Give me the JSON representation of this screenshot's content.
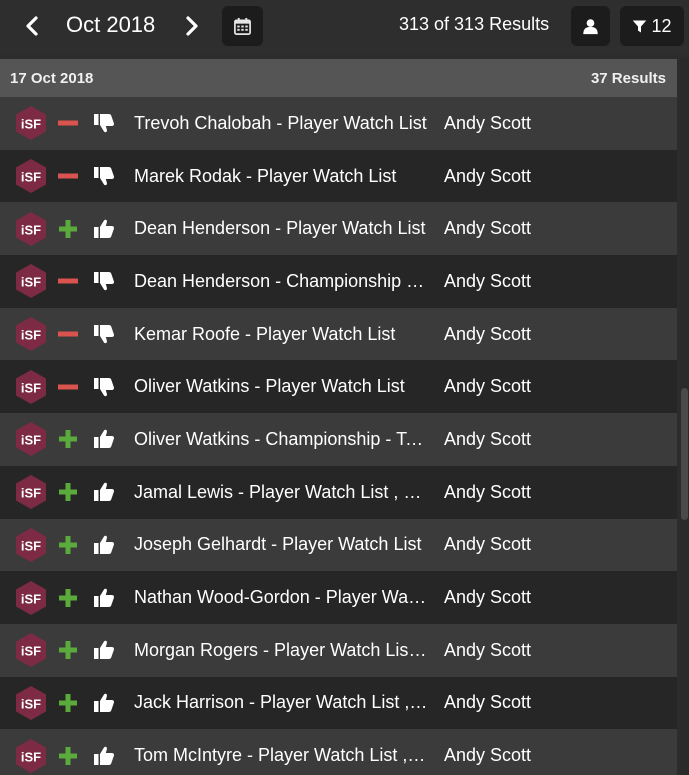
{
  "header": {
    "month": "Oct 2018",
    "results_summary": "313 of 313 Results",
    "filter_count": "12",
    "icons": {
      "prev": "chevron-left-icon",
      "next": "chevron-right-icon",
      "calendar": "calendar-icon",
      "user": "user-icon",
      "filter": "filter-icon"
    }
  },
  "section": {
    "date": "17 Oct 2018",
    "count": "37 Results"
  },
  "colors": {
    "logo_bg": "#7d2a45",
    "plus": "#5aaa3c",
    "minus": "#d9534f",
    "row_light": "#3b3b3b",
    "row_dark": "#262626",
    "header_bg": "#555555"
  },
  "logo_text": "iSF",
  "rows": [
    {
      "sentiment": "negative",
      "title": "Trevoh Chalobah - Player Watch List",
      "author": "Andy Scott"
    },
    {
      "sentiment": "negative",
      "title": "Marek Rodak - Player Watch List",
      "author": "Andy Scott"
    },
    {
      "sentiment": "positive",
      "title": "Dean Henderson - Player Watch List",
      "author": "Andy Scott"
    },
    {
      "sentiment": "negative",
      "title": "Dean Henderson - Championship - Team",
      "author": "Andy Scott"
    },
    {
      "sentiment": "negative",
      "title": "Kemar Roofe - Player Watch List",
      "author": "Andy Scott"
    },
    {
      "sentiment": "negative",
      "title": "Oliver Watkins - Player Watch List",
      "author": "Andy Scott"
    },
    {
      "sentiment": "positive",
      "title": "Oliver Watkins - Championship - Team",
      "author": "Andy Scott"
    },
    {
      "sentiment": "positive",
      "title": "Jamal Lewis - Player Watch List , Player",
      "author": "Andy Scott"
    },
    {
      "sentiment": "positive",
      "title": "Joseph Gelhardt - Player Watch List",
      "author": "Andy Scott"
    },
    {
      "sentiment": "positive",
      "title": "Nathan Wood-Gordon - Player Watch List",
      "author": "Andy Scott"
    },
    {
      "sentiment": "positive",
      "title": "Morgan Rogers - Player Watch List , Player",
      "author": "Andy Scott"
    },
    {
      "sentiment": "positive",
      "title": "Jack Harrison - Player Watch List , Player",
      "author": "Andy Scott"
    },
    {
      "sentiment": "positive",
      "title": "Tom McIntyre - Player Watch List , Player",
      "author": "Andy Scott"
    }
  ]
}
